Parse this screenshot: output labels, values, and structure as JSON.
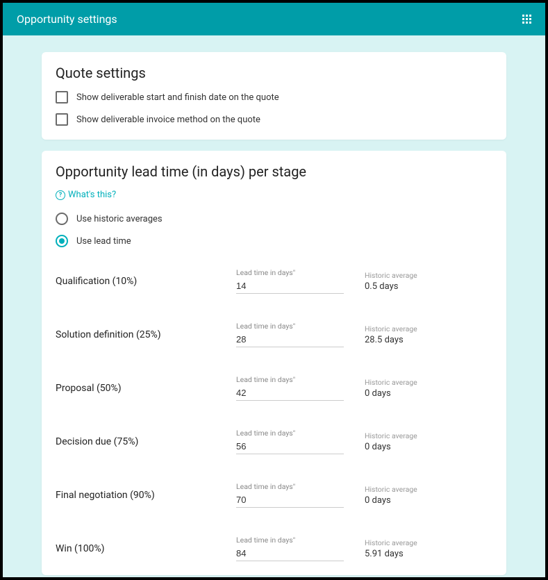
{
  "header": {
    "title": "Opportunity settings"
  },
  "quote_settings": {
    "title": "Quote settings",
    "checkboxes": [
      {
        "label": "Show deliverable start and finish date on the quote",
        "checked": false
      },
      {
        "label": "Show deliverable invoice method on the quote",
        "checked": false
      }
    ]
  },
  "lead_time": {
    "title": "Opportunity lead time (in days) per stage",
    "whats_this": "What's this?",
    "radios": [
      {
        "label": "Use historic averages",
        "checked": false
      },
      {
        "label": "Use lead time",
        "checked": true
      }
    ],
    "input_label": "Lead time in days\"",
    "avg_label": "Historic average",
    "stages": [
      {
        "name": "Qualification (10%)",
        "lead_time": "14",
        "historic_average": "0.5 days"
      },
      {
        "name": "Solution definition (25%)",
        "lead_time": "28",
        "historic_average": "28.5 days"
      },
      {
        "name": "Proposal (50%)",
        "lead_time": "42",
        "historic_average": "0 days"
      },
      {
        "name": "Decision due (75%)",
        "lead_time": "56",
        "historic_average": "0 days"
      },
      {
        "name": "Final negotiation (90%)",
        "lead_time": "70",
        "historic_average": "0 days"
      },
      {
        "name": "Win (100%)",
        "lead_time": "84",
        "historic_average": "5.91 days"
      }
    ]
  }
}
